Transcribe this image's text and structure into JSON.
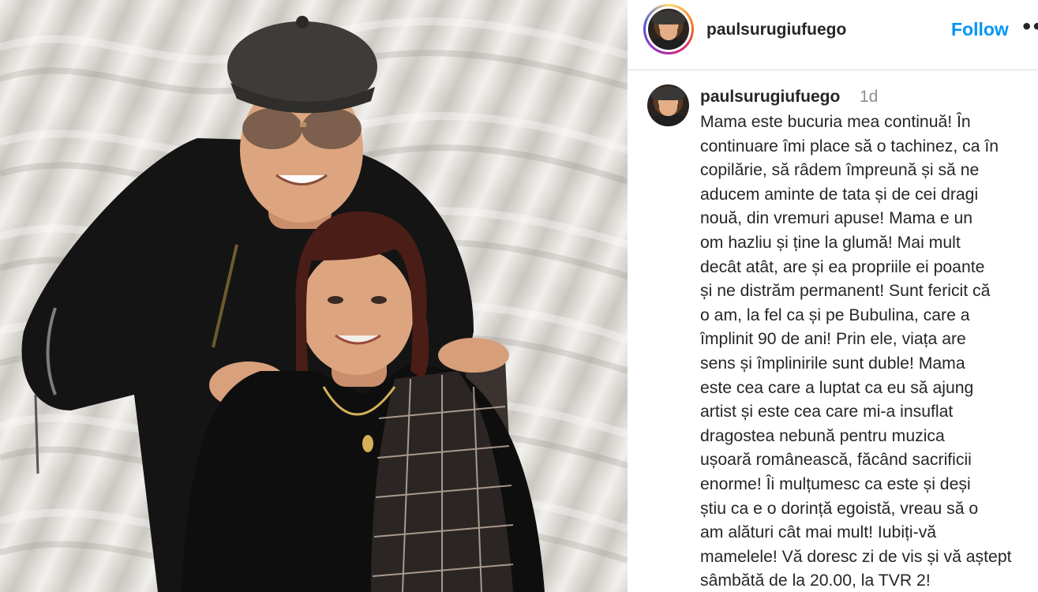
{
  "post": {
    "author": "paulsurugiufuego",
    "follow_label": "Follow",
    "more_label": "••",
    "time": "1d",
    "caption": "Mama este bucuria mea continuă! În\ncontinuare îmi place să o tachinez, ca în\ncopilărie, să râdem împreună și să ne\naducem aminte de tata și de cei dragi\nnouă, din vremuri apuse! Mama e un\nom hazliu și ține la glumă! Mai mult\ndecât atât, are și ea propriile ei poante\nși ne distrăm permanent! Sunt fericit că\no am, la fel ca și pe Bubulina, care a\nîmplinit 90 de ani! Prin ele, viața are\nsens și împlinirile sunt duble! Mama\neste cea care a luptat ca eu să ajung\nartist și este cea care mi-a insuflat\ndragostea nebună pentru muzica\nușoară românească, făcând sacrificii\nenorme! Îi mulțumesc ca este și deși\nștiu ca e o dorință egoistă, vreau să o\nam alături cât mai mult! Iubiți-vă\nmamelele! Vă doresc zi de vis și vă aștept\nsâmbătă de la 20.00, la TVR 2!"
  },
  "colors": {
    "follow": "#0095f6",
    "muted": "#8e8e8e",
    "text": "#262626"
  },
  "icons": {
    "more": "more-options-icon",
    "avatar": "profile-avatar"
  }
}
